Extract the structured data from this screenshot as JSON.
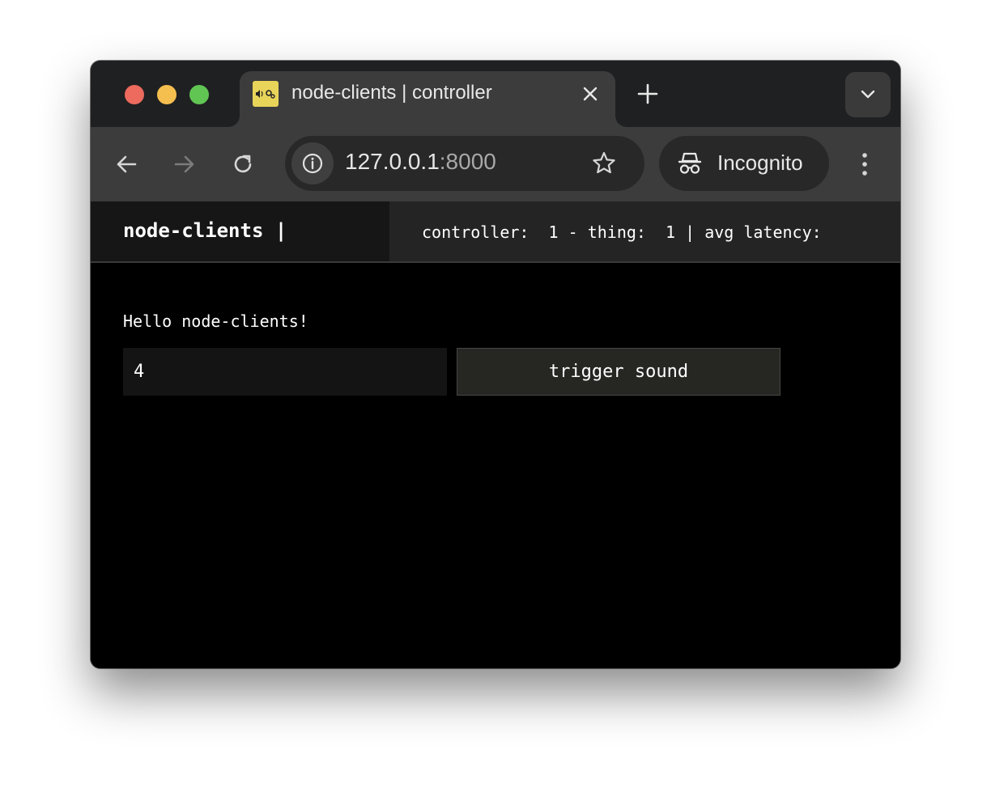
{
  "browser": {
    "tab": {
      "title": "node-clients | controller",
      "favicon": "speaker-and-gears-icon"
    },
    "address_bar": {
      "host": "127.0.0.1",
      "port": ":8000"
    },
    "profile": {
      "label": "Incognito"
    },
    "colors": {
      "tab_strip": "#1f2021",
      "toolbar": "#3c3c3c",
      "favicon_bg": "#e9d45a",
      "traffic_red": "#ed6a5e",
      "traffic_yellow": "#f5bf4f",
      "traffic_green": "#61c554"
    }
  },
  "app": {
    "header": {
      "brand": "node-clients |",
      "stats": "controller:  1 - thing:  1 | avg latency:"
    },
    "main": {
      "greeting": "Hello node-clients!",
      "number_input": {
        "value": "4"
      },
      "trigger_button": {
        "label": "trigger sound"
      }
    }
  }
}
